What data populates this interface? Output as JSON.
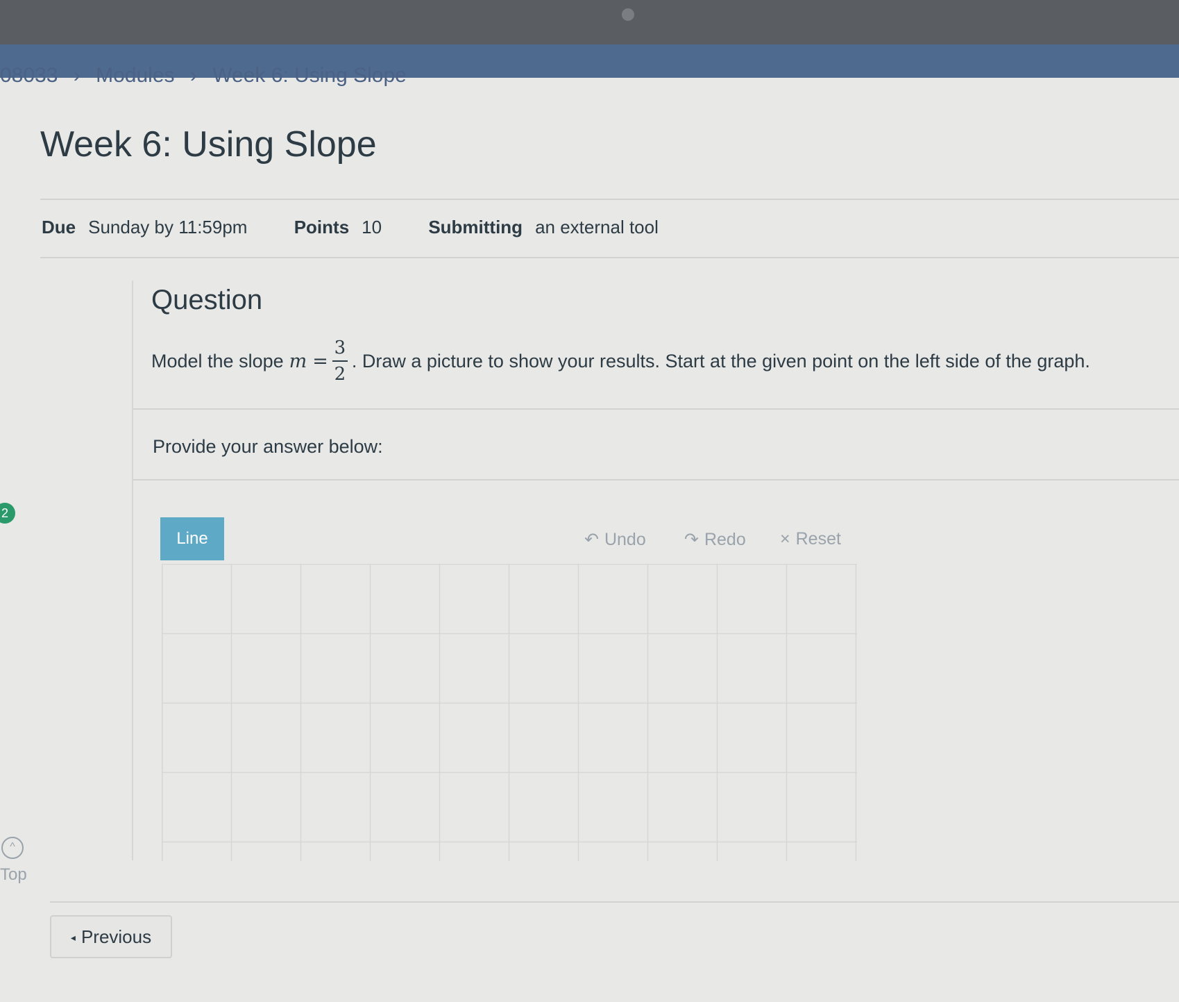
{
  "breadcrumb": {
    "course": "08033",
    "sep1": "›",
    "modules": "Modules",
    "sep2": "›",
    "current": "Week 6: Using Slope"
  },
  "page_title": "Week 6: Using Slope",
  "meta": {
    "due_label": "Due",
    "due_value": "Sunday by 11:59pm",
    "points_label": "Points",
    "points_value": "10",
    "submitting_label": "Submitting",
    "submitting_value": "an external tool"
  },
  "question": {
    "heading": "Question",
    "prefix": "Model the slope",
    "math_var": "m",
    "equals": "=",
    "numerator": "3",
    "denominator": "2",
    "suffix": ". Draw a picture to show your results. Start at the given point on the left side of the graph.",
    "provide": "Provide your answer below:"
  },
  "badge": "2",
  "toolbar": {
    "line_label": "Line",
    "undo_icon": "↶",
    "undo_label": "Undo",
    "redo_icon": "↷",
    "redo_label": "Redo",
    "reset_icon": "×",
    "reset_label": "Reset"
  },
  "grid": {
    "columns": 10,
    "rows": 4,
    "line_color": "#d6d6d4"
  },
  "nav": {
    "top_icon": "^",
    "top_label": "Top",
    "previous_icon": "◂",
    "previous_label": "Previous"
  },
  "colors": {
    "accent": "#5ea9c5",
    "text": "#2d3b45",
    "muted": "#9aa3ab",
    "header": "#4e6a8e"
  }
}
